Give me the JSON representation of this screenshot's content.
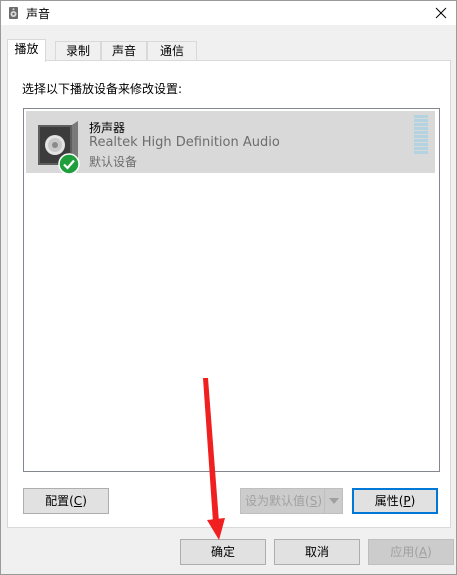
{
  "window": {
    "title": "声音",
    "icons": {
      "app": "speaker-icon",
      "close": "close-icon"
    }
  },
  "tabs": [
    {
      "label": "播放",
      "active": true
    },
    {
      "label": "录制",
      "active": false
    },
    {
      "label": "声音",
      "active": false
    },
    {
      "label": "通信",
      "active": false
    }
  ],
  "playback": {
    "instruction": "选择以下播放设备来修改设置:",
    "devices": [
      {
        "name": "扬声器",
        "driver": "Realtek High Definition Audio",
        "status": "默认设备",
        "icon": "speaker-icon",
        "badge": "check-icon",
        "selected": true
      }
    ],
    "buttons": {
      "configure": {
        "label": "配置(",
        "key": "C",
        "suffix": ")"
      },
      "set_default": {
        "label": "设为默认值(",
        "key": "S",
        "suffix": ")",
        "enabled": false
      },
      "properties": {
        "label": "属性(",
        "key": "P",
        "suffix": ")"
      }
    }
  },
  "footer": {
    "ok": "确定",
    "cancel": "取消",
    "apply": {
      "label": "应用(",
      "key": "A",
      "suffix": ")",
      "enabled": false
    }
  },
  "colors": {
    "accent": "#0078d7",
    "selection": "#d9d9d9",
    "annotation_arrow": "#f02020",
    "check_badge": "#1e9e3c"
  }
}
